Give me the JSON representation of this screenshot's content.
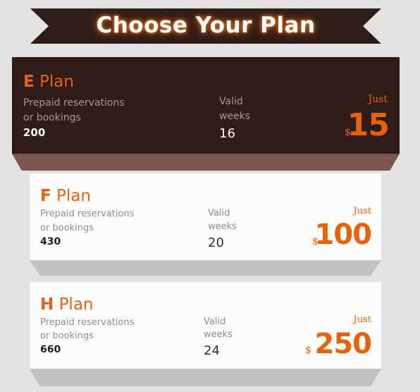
{
  "banner": {
    "title": "Choose Your Plan"
  },
  "colors": {
    "accent": "#e8620e",
    "dark_card": "#2f1b18",
    "dark_card_base": "#7a5650",
    "light_card": "#fdfcfb",
    "light_card_base": "#c4c2c0",
    "ribbon": "#2e1c19"
  },
  "plans": [
    {
      "letter": "E",
      "word": "Plan",
      "label_line1": "Prepaid reservations",
      "label_line2": "or bookings",
      "bookings": "200",
      "valid_line1": "Valid",
      "valid_line2": "weeks",
      "weeks": "16",
      "just": "Just",
      "currency": "$",
      "price": "15"
    },
    {
      "letter": "F",
      "word": "Plan",
      "label_line1": "Prepaid reservations",
      "label_line2": "or bookings",
      "bookings": "430",
      "valid_line1": "Valid",
      "valid_line2": "weeks",
      "weeks": "20",
      "just": "Just",
      "currency": "$",
      "price": "100"
    },
    {
      "letter": "H",
      "word": "Plan",
      "label_line1": "Prepaid reservations",
      "label_line2": "or bookings",
      "bookings": "660",
      "valid_line1": "Valid",
      "valid_line2": "weeks",
      "weeks": "24",
      "just": "Just",
      "currency": "$",
      "price": "250"
    }
  ]
}
